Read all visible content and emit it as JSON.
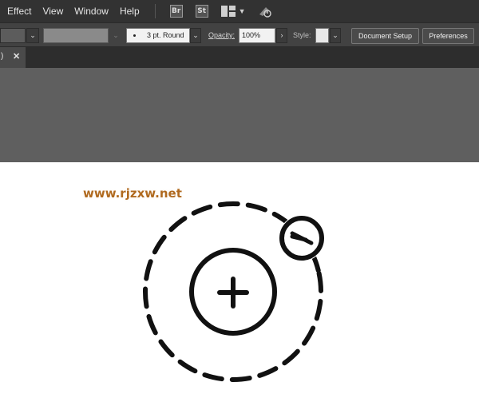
{
  "menubar": {
    "items": [
      "Effect",
      "View",
      "Window",
      "Help"
    ],
    "bridge_label": "Br",
    "stock_label": "St"
  },
  "controlbar": {
    "stroke_profile": "3 pt. Round",
    "opacity_label": "Opacity:",
    "opacity_value": "100%",
    "style_label": "Style:",
    "document_setup": "Document Setup",
    "preferences": "Preferences"
  },
  "tab": {
    "prefix": ")",
    "close": "✕"
  },
  "watermark": "www.rjzxw.net",
  "colors": {
    "menubar_bg": "#323232",
    "controlbar_bg": "#424242",
    "canvas_bg": "#5f5f5f",
    "artboard_bg": "#ffffff",
    "art_stroke": "#111111",
    "watermark": "#b06a1f"
  }
}
